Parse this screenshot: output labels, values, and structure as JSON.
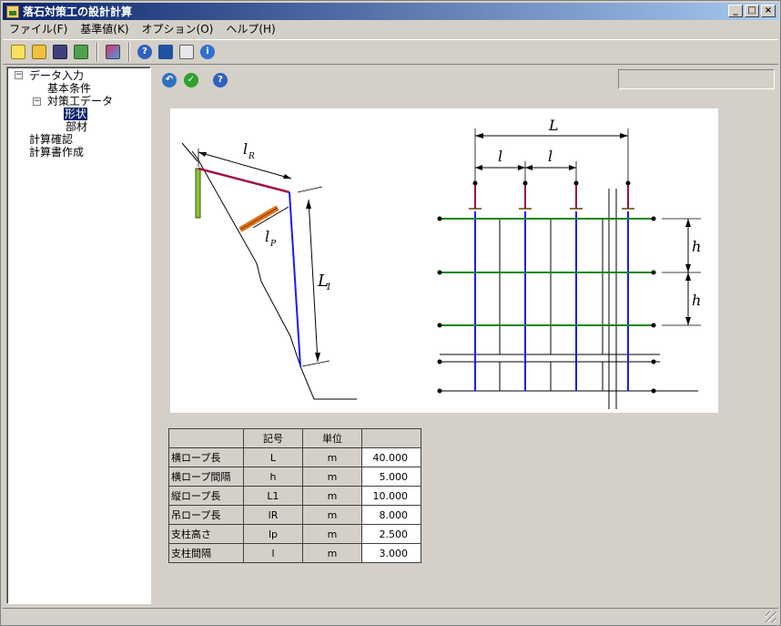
{
  "window": {
    "title": "落石対策工の設計計算",
    "buttons": [
      "_",
      "□",
      "×"
    ]
  },
  "menu": [
    {
      "label": "ファイル(F)"
    },
    {
      "label": "基準値(K)"
    },
    {
      "label": "オプション(O)"
    },
    {
      "label": "ヘルプ(H)"
    }
  ],
  "toolbar": {
    "buttons": [
      "new-icon",
      "open-icon",
      "save-icon",
      "export-icon",
      "color-icon",
      "help-icon",
      "book-icon",
      "card-icon",
      "info-icon"
    ]
  },
  "tree": {
    "root": "データ入力",
    "items": [
      {
        "label": "基本条件"
      },
      {
        "label": "対策工データ"
      },
      {
        "label": "形状"
      },
      {
        "label": "部材"
      },
      {
        "label": "計算確認"
      },
      {
        "label": "計算書作成"
      }
    ],
    "selected": "形状"
  },
  "content_toolbar": {
    "buttons": [
      "back-icon",
      "check-icon",
      "help-icon"
    ]
  },
  "diagram": {
    "labels": {
      "lR": "l",
      "lR_sub": "R",
      "lP": "l",
      "lP_sub": "P",
      "L1": "L",
      "L1_sub": "1",
      "L": "L",
      "l": "l",
      "h": "h"
    }
  },
  "table": {
    "headers": [
      "",
      "記号",
      "単位",
      ""
    ],
    "rows": [
      {
        "name": "横ロープ長",
        "symbol": "L",
        "unit": "m",
        "value": "40.000"
      },
      {
        "name": "横ロープ間隔",
        "symbol": "h",
        "unit": "m",
        "value": "5.000"
      },
      {
        "name": "縦ロープ長",
        "symbol": "L1",
        "unit": "m",
        "value": "10.000"
      },
      {
        "name": "吊ロープ長",
        "symbol": "lR",
        "unit": "m",
        "value": "8.000"
      },
      {
        "name": "支柱高さ",
        "symbol": "lp",
        "unit": "m",
        "value": "2.500"
      },
      {
        "name": "支柱間隔",
        "symbol": "l",
        "unit": "m",
        "value": "3.000"
      }
    ]
  },
  "colors": {
    "titlebar": "#0a246a",
    "rope_green": "#118811",
    "rope_blue": "#1a1aff",
    "anchor_red": "#a0104a",
    "post_orange": "#e07010"
  }
}
